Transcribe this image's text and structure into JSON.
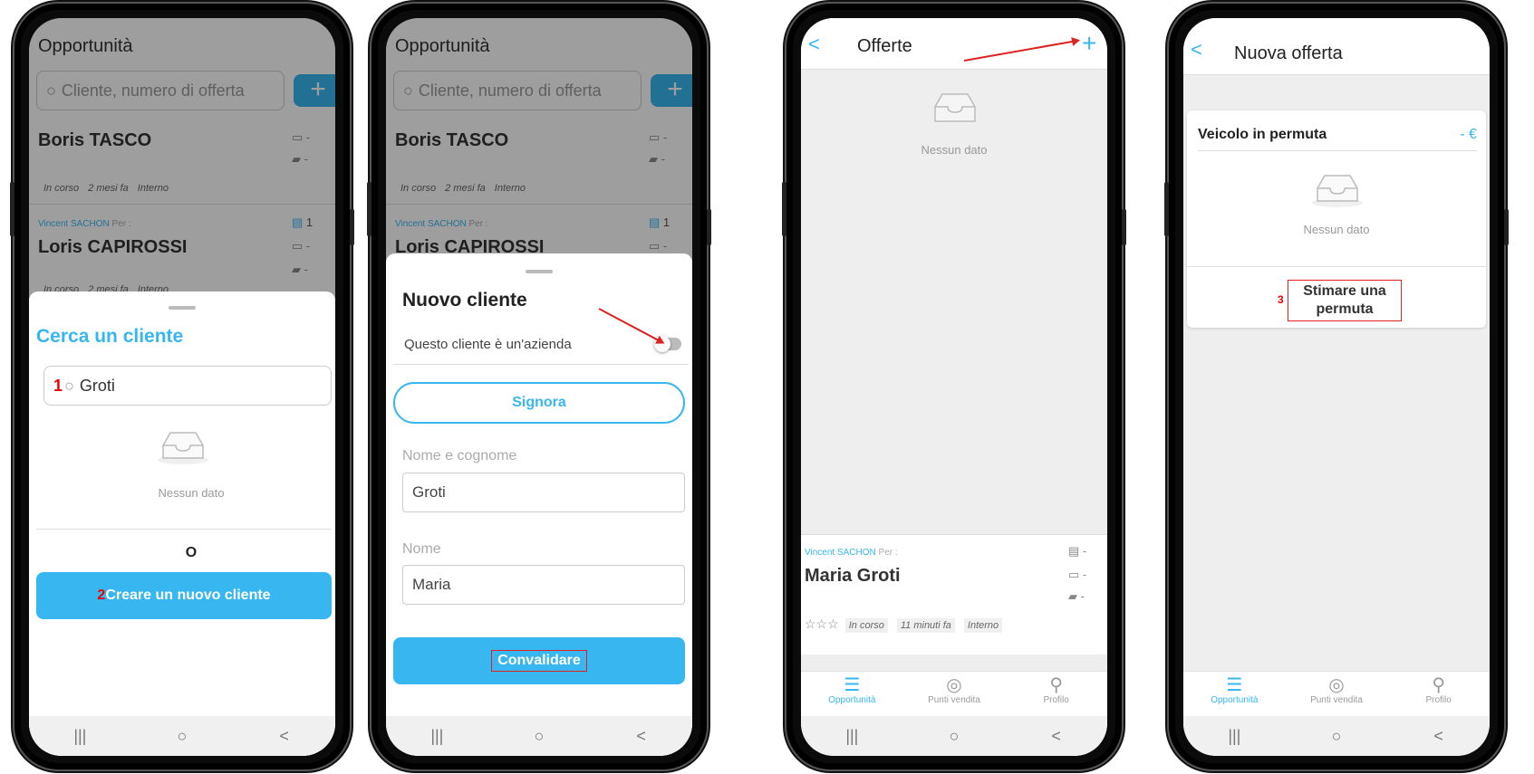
{
  "colors": {
    "accent": "#37b6f0",
    "annotation": "#dd2222"
  },
  "screen1": {
    "title": "Opportunità",
    "search_placeholder": "Cliente, numero di offerta",
    "plus_label": "+",
    "cust1": {
      "name": "Boris TASCO",
      "tags": [
        "In corso",
        "2 mesi fa",
        "Interno"
      ],
      "cart": "-",
      "chat": "-"
    },
    "cust2": {
      "agent": "Vincent SACHON",
      "per": "Per :",
      "name": "Loris CAPIROSSI",
      "doc": "1",
      "cart": "-",
      "chat": "-",
      "tags": [
        "In corso",
        "2 mesi fa",
        "Interno"
      ]
    },
    "sheet_title": "Cerca un cliente",
    "step1": "1",
    "search_value": "Groti",
    "nodata": "Nessun dato",
    "or": "O",
    "step2": "2",
    "create_btn": "Creare un nuovo cliente"
  },
  "screen2": {
    "title": "Opportunità",
    "search_placeholder": "Cliente, numero di offerta",
    "cust1": {
      "name": "Boris TASCO",
      "tags": [
        "In corso",
        "2 mesi fa",
        "Interno"
      ],
      "cart": "-",
      "chat": "-"
    },
    "cust2": {
      "agent": "Vincent SACHON",
      "per": "Per :",
      "name": "Loris CAPIROSSI",
      "doc": "1",
      "cart": "-"
    },
    "sheet_title": "Nuovo cliente",
    "company_toggle": "Questo cliente è un'azienda",
    "title_btn": "Signora",
    "fullname_label": "Nome e cognome",
    "fullname_value": "Groti",
    "firstname_label": "Nome",
    "firstname_value": "Maria",
    "submit_btn": "Convalidare"
  },
  "screen3": {
    "back": "<",
    "title": "Offerte",
    "plus": "+",
    "nodata": "Nessun dato",
    "card": {
      "agent": "Vincent SACHON",
      "per": "Per :",
      "name": "Maria Groti",
      "doc": "-",
      "cart": "-",
      "chat": "-",
      "stars": "☆☆☆",
      "tags": [
        "In corso",
        "11 minuti fa",
        "Interno"
      ]
    }
  },
  "screen4": {
    "back": "<",
    "title": "Nuova offerta",
    "section": "Veicolo in permuta",
    "amount": "- €",
    "nodata": "Nessun dato",
    "step3": "3",
    "estimate_btn": "Stimare una permuta"
  },
  "tabbar": {
    "tab1": "Opportunità",
    "tab2": "Punti vendita",
    "tab3": "Profilo"
  },
  "icons": {
    "recent": "|||",
    "home": "○",
    "back": "<",
    "list": "☰",
    "pin": "◎",
    "user": "⚲",
    "search": "⌕",
    "cart": "🛒︎",
    "chat": "▰"
  }
}
